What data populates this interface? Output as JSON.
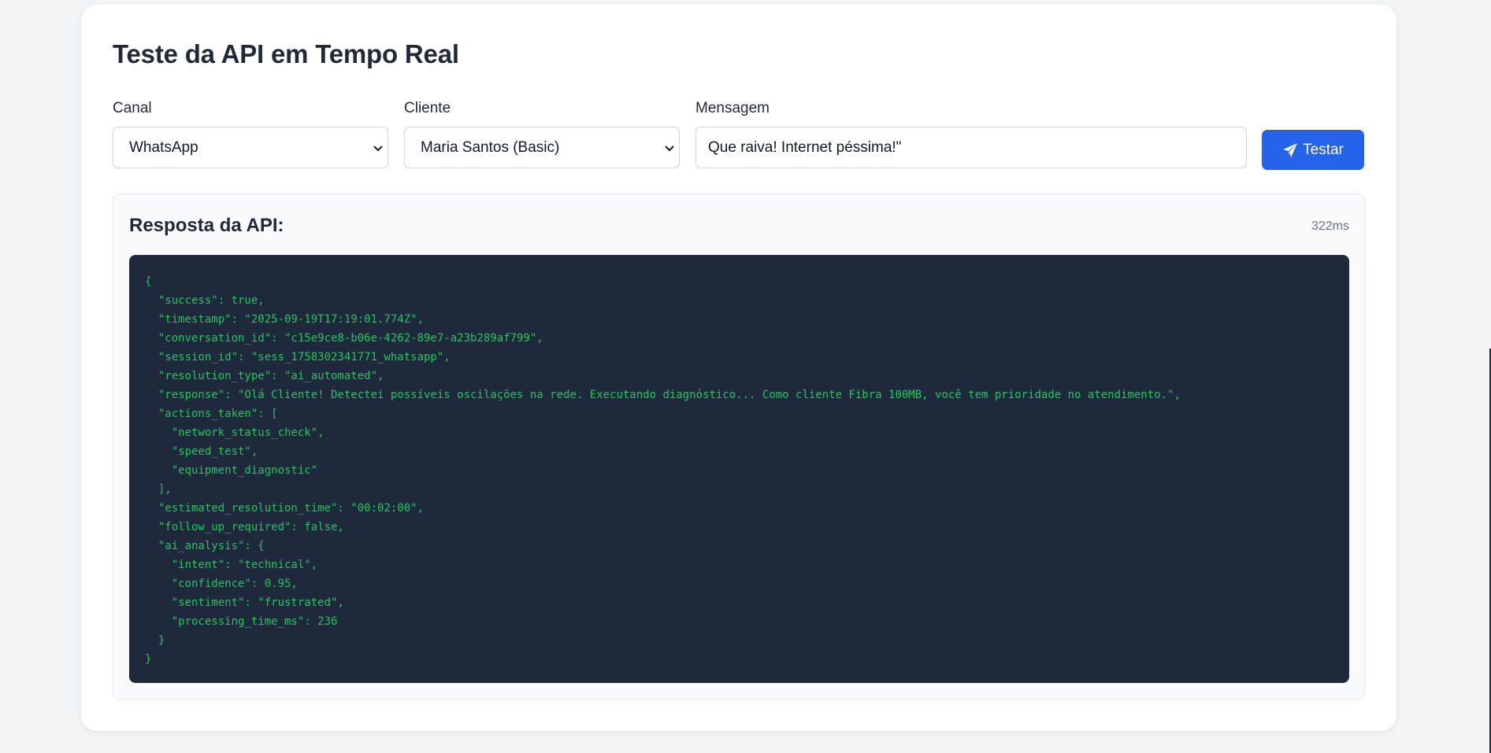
{
  "page": {
    "title": "Teste da API em Tempo Real"
  },
  "form": {
    "channel": {
      "label": "Canal",
      "selected": "WhatsApp"
    },
    "client": {
      "label": "Cliente",
      "selected": "Maria Santos (Basic)"
    },
    "message": {
      "label": "Mensagem",
      "value": "Que raiva! Internet péssima!\""
    },
    "test_button": {
      "label": "Testar",
      "icon": "paper-plane-icon"
    }
  },
  "response": {
    "title": "Resposta da API:",
    "time": "322ms",
    "json": "{\n  \"success\": true,\n  \"timestamp\": \"2025-09-19T17:19:01.774Z\",\n  \"conversation_id\": \"c15e9ce8-b06e-4262-89e7-a23b289af799\",\n  \"session_id\": \"sess_1758302341771_whatsapp\",\n  \"resolution_type\": \"ai_automated\",\n  \"response\": \"Olá Cliente! Detectei possíveis oscilações na rede. Executando diagnóstico... Como cliente Fibra 100MB, você tem prioridade no atendimento.\",\n  \"actions_taken\": [\n    \"network_status_check\",\n    \"speed_test\",\n    \"equipment_diagnostic\"\n  ],\n  \"estimated_resolution_time\": \"00:02:00\",\n  \"follow_up_required\": false,\n  \"ai_analysis\": {\n    \"intent\": \"technical\",\n    \"confidence\": 0.95,\n    \"sentiment\": \"frustrated\",\n    \"processing_time_ms\": 236\n  }\n}"
  },
  "colors": {
    "accent": "#2563eb",
    "code_bg": "#1e293b",
    "code_text": "#22c55e"
  }
}
